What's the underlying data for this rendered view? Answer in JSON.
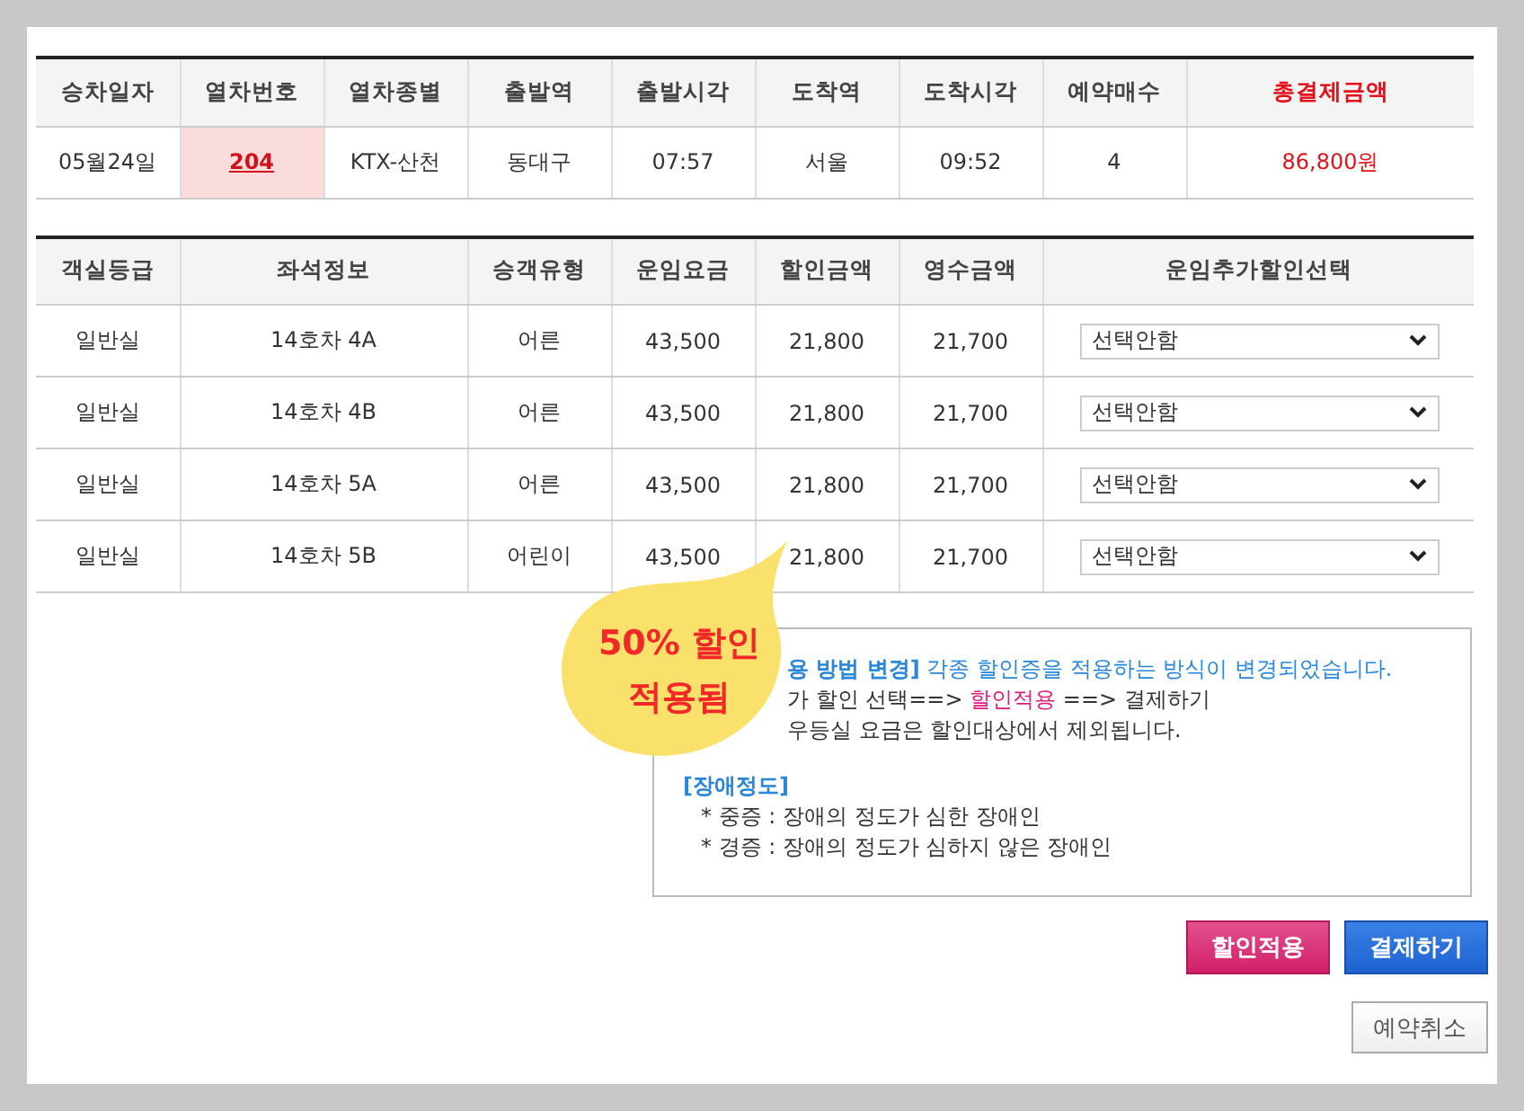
{
  "summary": {
    "columns": [
      {
        "label": "승차일자",
        "kind": "plain"
      },
      {
        "label": "열차번호",
        "kind": "plain"
      },
      {
        "label": "열차종별",
        "kind": "plain"
      },
      {
        "label": "출발역",
        "kind": "plain"
      },
      {
        "label": "출발시각",
        "kind": "plain"
      },
      {
        "label": "도착역",
        "kind": "plain"
      },
      {
        "label": "도착시각",
        "kind": "plain"
      },
      {
        "label": "예약매수",
        "kind": "plain"
      },
      {
        "label": "총결제금액",
        "kind": "total"
      }
    ],
    "cells": [
      {
        "text": "05월24일",
        "kind": "plain"
      },
      {
        "text": "204",
        "kind": "train"
      },
      {
        "text": "KTX-산천",
        "kind": "plain"
      },
      {
        "text": "동대구",
        "kind": "plain"
      },
      {
        "text": "07:57",
        "kind": "plain"
      },
      {
        "text": "서울",
        "kind": "plain"
      },
      {
        "text": "09:52",
        "kind": "plain"
      },
      {
        "text": "4",
        "kind": "plain"
      },
      {
        "text": "86,800원",
        "kind": "total"
      }
    ]
  },
  "seats": {
    "columns": [
      "객실등급",
      "좌석정보",
      "승객유형",
      "운임요금",
      "할인금액",
      "영수금액",
      "운임추가할인선택"
    ],
    "rows": [
      {
        "cells": [
          "일반실",
          "14호차 4A",
          "어른",
          "43,500",
          "21,800",
          "21,700"
        ],
        "option": "선택안함"
      },
      {
        "cells": [
          "일반실",
          "14호차 4B",
          "어른",
          "43,500",
          "21,800",
          "21,700"
        ],
        "option": "선택안함"
      },
      {
        "cells": [
          "일반실",
          "14호차 5A",
          "어른",
          "43,500",
          "21,800",
          "21,700"
        ],
        "option": "선택안함"
      },
      {
        "cells": [
          "일반실",
          "14호차 5B",
          "어린이",
          "43,500",
          "21,800",
          "21,700"
        ],
        "option": "선택안함"
      }
    ]
  },
  "callout": {
    "text": "50% 할인 적용됨"
  },
  "notice": {
    "partial_lines": [
      [
        {
          "kind": "heading",
          "text": "용 방법 변경]"
        },
        {
          "kind": "info",
          "text": " 각종 할인증을 적용하는 방식이 변경되었습니다."
        }
      ],
      [
        {
          "kind": "plain",
          "text": "가 할인 선택==> "
        },
        {
          "kind": "highlight",
          "text": "할인적용"
        },
        {
          "kind": "plain",
          "text": " ==> 결제하기"
        }
      ],
      [
        {
          "kind": "plain",
          "text": "우등실 요금은 할인대상에서 제외됩니다."
        }
      ]
    ],
    "heading": "[장애정도]",
    "items": [
      "* 중증 : 장애의 정도가 심한 장애인",
      "* 경증 : 장애의 정도가 심하지 않은 장애인"
    ]
  },
  "actions": [
    {
      "label": "할인적용",
      "kind": "discount"
    },
    {
      "label": "결제하기",
      "kind": "pay"
    }
  ],
  "cancel": {
    "label": "예약취소"
  }
}
